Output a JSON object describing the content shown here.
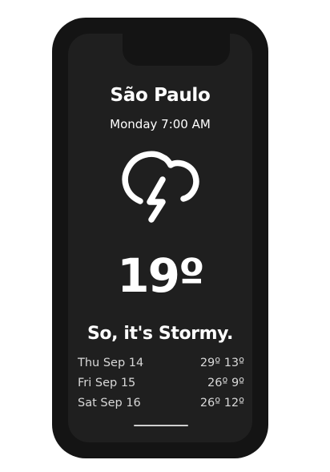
{
  "location": {
    "city": "São Paulo",
    "datetime": "Monday 7:00 AM"
  },
  "current": {
    "icon": "thunderstorm-cloud-icon",
    "temperature": "19º",
    "condition": "So, it's Stormy."
  },
  "forecast": [
    {
      "day": "Thu Sep 14",
      "temps": "29º 13º"
    },
    {
      "day": "Fri Sep 15",
      "temps": "26º 9º"
    },
    {
      "day": "Sat Sep 16",
      "temps": "26º 12º"
    }
  ],
  "colors": {
    "device_frame": "#141414",
    "screen_background": "#1f1f1f",
    "text": "#ffffff"
  }
}
